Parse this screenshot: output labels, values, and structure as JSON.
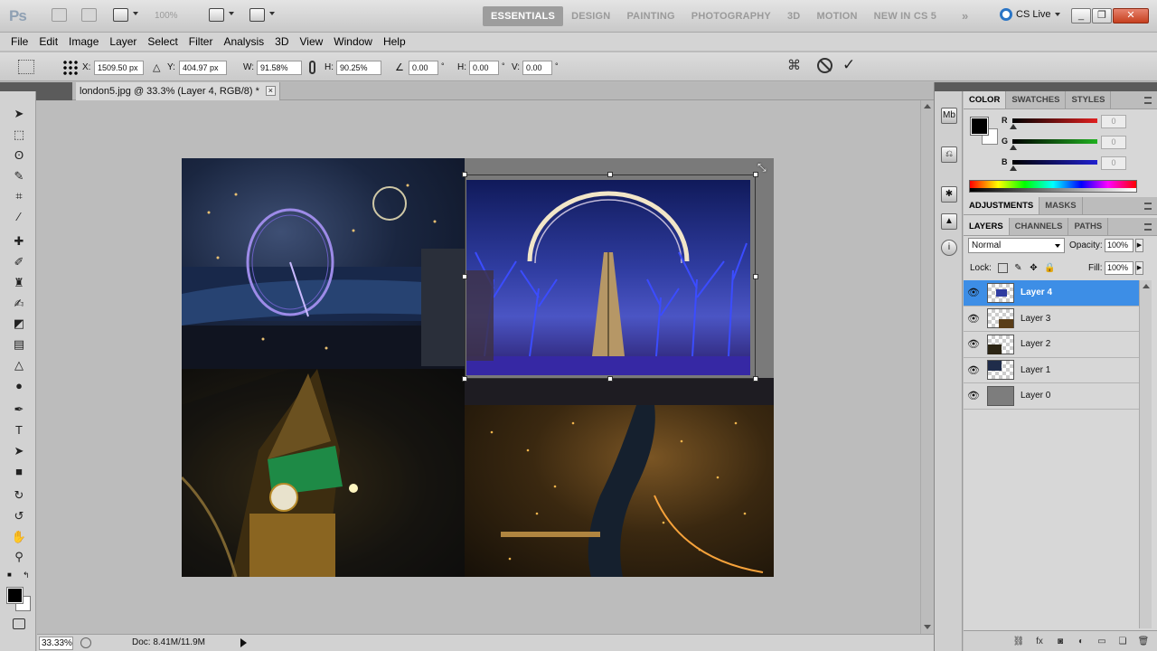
{
  "appbar": {
    "logo": "Ps",
    "zoom": "100%",
    "workspaces": [
      "ESSENTIALS",
      "DESIGN",
      "PAINTING",
      "PHOTOGRAPHY",
      "3D",
      "MOTION",
      "NEW IN CS 5"
    ],
    "active_workspace": "ESSENTIALS",
    "more": "»",
    "cs_live": "CS Live",
    "minimize": "_",
    "restore": "❐",
    "close": "✕"
  },
  "menu": [
    "File",
    "Edit",
    "Image",
    "Layer",
    "Select",
    "Filter",
    "Analysis",
    "3D",
    "View",
    "Window",
    "Help"
  ],
  "options": {
    "x_label": "X:",
    "x_value": "1509.50 px",
    "y_label": "Y:",
    "y_value": "404.97 px",
    "w_label": "W:",
    "w_value": "91.58%",
    "h_label": "H:",
    "h_value": "90.25%",
    "rotate_value": "0.00",
    "rotate_unit": "°",
    "hskew_label": "H:",
    "hskew_value": "0.00",
    "hskew_unit": "°",
    "vskew_label": "V:",
    "vskew_value": "0.00",
    "vskew_unit": "°"
  },
  "document": {
    "tab_title": "london5.jpg @ 33.3% (Layer 4, RGB/8) *",
    "tab_close": "×",
    "zoom": "33.33%",
    "doc_size": "Doc: 8.41M/11.9M"
  },
  "color_panel": {
    "tabs": [
      "COLOR",
      "SWATCHES",
      "STYLES"
    ],
    "channels": [
      {
        "label": "R",
        "value": "0",
        "color": "#e02020"
      },
      {
        "label": "G",
        "value": "0",
        "color": "#20b020"
      },
      {
        "label": "B",
        "value": "0",
        "color": "#2020d0"
      }
    ]
  },
  "adjustments_panel": {
    "tabs": [
      "ADJUSTMENTS",
      "MASKS"
    ]
  },
  "layers_panel": {
    "tabs": [
      "LAYERS",
      "CHANNELS",
      "PATHS"
    ],
    "blend_mode": "Normal",
    "opacity_label": "Opacity:",
    "opacity": "100%",
    "lock_label": "Lock:",
    "fill_label": "Fill:",
    "fill": "100%",
    "layers": [
      {
        "name": "Layer 4",
        "selected": true
      },
      {
        "name": "Layer 3",
        "selected": false
      },
      {
        "name": "Layer 2",
        "selected": false
      },
      {
        "name": "Layer 1",
        "selected": false
      },
      {
        "name": "Layer 0",
        "selected": false
      }
    ]
  },
  "accent": "#3d8ee6"
}
